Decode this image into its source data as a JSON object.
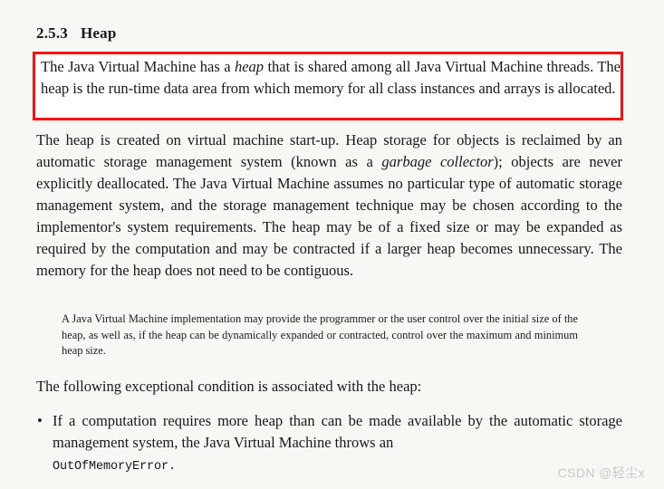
{
  "document": {
    "background_color": "#f7f7f4",
    "text_color": "#18181c"
  },
  "heading": {
    "number": "2.5.3",
    "title": "Heap"
  },
  "highlight": {
    "border_color": "#fb0f0f",
    "background_color": "#ffffff",
    "text_part1": "The Java Virtual Machine has a ",
    "emphasis1": "heap",
    "text_part2": " that is shared among all Java Virtual Machine threads. The heap is the run-time data area from which memory for all class instances and arrays is allocated."
  },
  "paragraphs": {
    "p2_part1": "The heap is created on virtual machine start-up. Heap storage for objects is reclaimed by an automatic storage management system (known as a ",
    "p2_emphasis": "garbage collector",
    "p2_part2": "); objects are never explicitly deallocated. The Java Virtual Machine assumes no particular type of automatic storage management system, and the storage management technique may be chosen according to the implementor's system requirements. The heap may be of a fixed size or may be expanded as required by the computation and may be contracted if a larger heap becomes unnecessary. The memory for the heap does not need to be contiguous.",
    "p3": "The following exceptional condition is associated with the heap:"
  },
  "note": {
    "text": "A Java Virtual Machine implementation may provide the programmer or the user control over the initial size of the heap, as well as, if the heap can be dynamically expanded or contracted, control over the maximum and minimum heap size."
  },
  "bullets": [
    {
      "marker": "•",
      "text": "If a computation requires more heap than can be made available by the automatic storage management system, the Java Virtual Machine throws an",
      "code": "OutOfMemoryError",
      "trailing": "."
    }
  ],
  "watermark": {
    "text": "CSDN @轻尘x",
    "color": "#c9c9cc"
  }
}
